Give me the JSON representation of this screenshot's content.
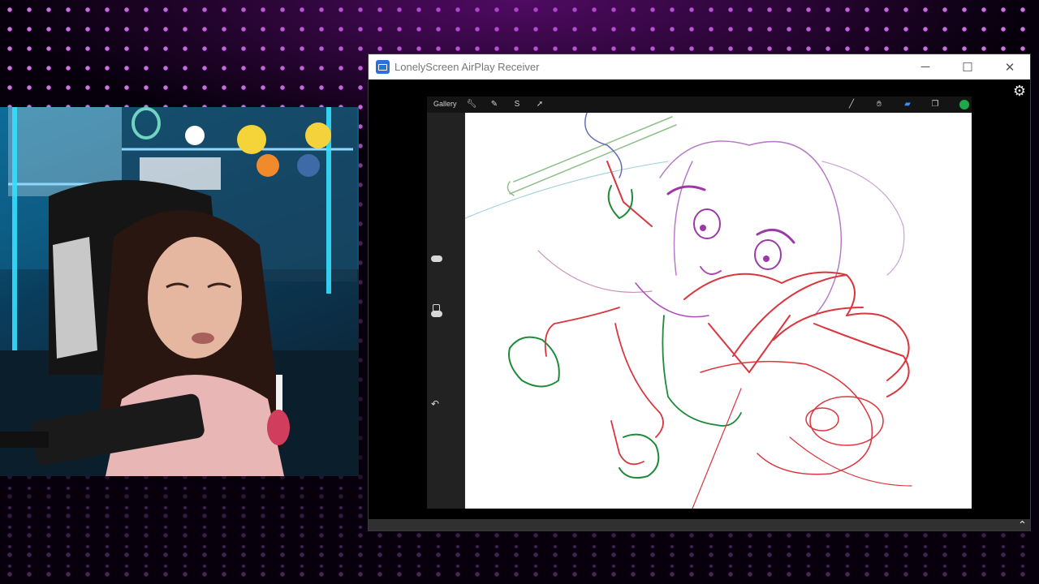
{
  "window": {
    "title": "LonelyScreen AirPlay Receiver",
    "controls": {
      "minimize": "─",
      "maximize": "☐",
      "close": "✕"
    }
  },
  "procreate": {
    "gallery_label": "Gallery",
    "tools": [
      "brush-icon",
      "smudge-icon",
      "eraser-icon",
      "layers-icon"
    ],
    "actions": [
      "wrench-icon",
      "adjustments-icon",
      "selection-icon",
      "transform-icon"
    ],
    "current_color": "#1ea84a"
  },
  "icons": {
    "settings": "⚙",
    "expand": "⌄",
    "undo": "↶"
  },
  "colors": {
    "accent_purple": "#c040ff",
    "sketch_red": "#d9363e",
    "sketch_pink": "#b04ab8",
    "sketch_green": "#1f8a3a"
  }
}
